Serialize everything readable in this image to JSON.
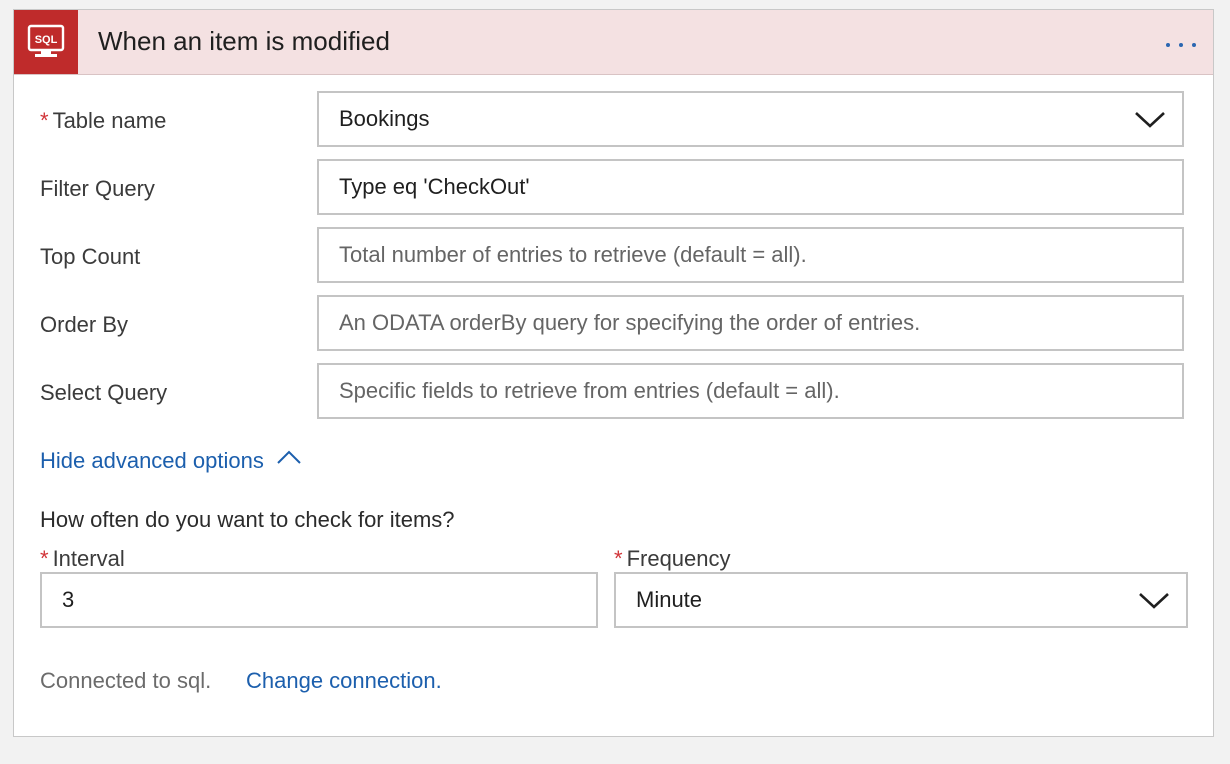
{
  "header": {
    "icon": "sql-icon",
    "icon_text": "SQL",
    "title": "When an item is modified",
    "more_icon": "more-horizontal-icon",
    "background": "#f4e1e2",
    "icon_color": "#bf2b2b"
  },
  "fields": {
    "table_name": {
      "required_mark": "*",
      "label": "Table name",
      "value": "Bookings"
    },
    "filter_query": {
      "label": "Filter Query",
      "value": "Type eq 'CheckOut'"
    },
    "top_count": {
      "label": "Top Count",
      "placeholder": "Total number of entries to retrieve (default = all)."
    },
    "order_by": {
      "label": "Order By",
      "placeholder": "An ODATA orderBy query for specifying the order of entries."
    },
    "select_query": {
      "label": "Select Query",
      "placeholder": "Specific fields to retrieve from entries (default = all)."
    }
  },
  "advanced": {
    "toggle_label": "Hide advanced options",
    "toggle_icon": "chevron-up-icon",
    "question": "How often do you want to check for items?"
  },
  "schedule": {
    "interval": {
      "required_mark": "*",
      "label": "Interval",
      "value": "3"
    },
    "frequency": {
      "required_mark": "*",
      "label": "Frequency",
      "value": "Minute"
    }
  },
  "connection": {
    "status": "Connected to sql.",
    "change_label": "Change connection.",
    "link_color": "#1c5fad"
  }
}
